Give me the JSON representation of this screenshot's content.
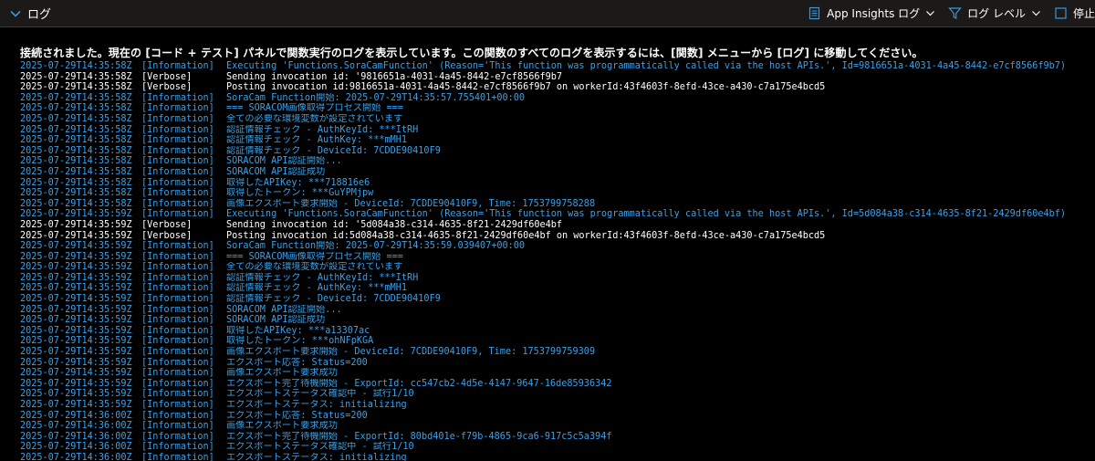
{
  "header": {
    "title": "ログ",
    "app_insights_label": "App Insights ログ",
    "log_level_label": "ログ レベル",
    "stop_label": "停止"
  },
  "colors": {
    "information": "#3aa0e8",
    "verbose": "#ffffff",
    "accent": "#3a96dd"
  },
  "notice": "接続されました。現在の [コード + テスト] パネルで関数実行のログを表示しています。この関数のすべてのログを表示するには、[関数] メニューから [ログ] に移動してください。",
  "logs": [
    {
      "ts": "2025-07-29T14:35:58Z",
      "level": "[Information]",
      "kind": "info",
      "msg": "Executing 'Functions.SoraCamFunction' (Reason='This function was programmatically called via the host APIs.', Id=9816651a-4031-4a45-8442-e7cf8566f9b7)"
    },
    {
      "ts": "2025-07-29T14:35:58Z",
      "level": "[Verbose]",
      "kind": "verb",
      "msg": "Sending invocation id: '9816651a-4031-4a45-8442-e7cf8566f9b7"
    },
    {
      "ts": "2025-07-29T14:35:58Z",
      "level": "[Verbose]",
      "kind": "verb",
      "msg": "Posting invocation id:9816651a-4031-4a45-8442-e7cf8566f9b7 on workerId:43f4603f-8efd-43ce-a430-c7a175e4bcd5"
    },
    {
      "ts": "2025-07-29T14:35:58Z",
      "level": "[Information]",
      "kind": "info",
      "msg": "SoraCam Function開始: 2025-07-29T14:35:57.755401+00:00"
    },
    {
      "ts": "2025-07-29T14:35:58Z",
      "level": "[Information]",
      "kind": "info",
      "msg": "=== SORACOM画像取得プロセス開始 ==="
    },
    {
      "ts": "2025-07-29T14:35:58Z",
      "level": "[Information]",
      "kind": "info",
      "msg": "全ての必要な環境変数が設定されています"
    },
    {
      "ts": "2025-07-29T14:35:58Z",
      "level": "[Information]",
      "kind": "info",
      "msg": "認証情報チェック - AuthKeyId: ***ItRH"
    },
    {
      "ts": "2025-07-29T14:35:58Z",
      "level": "[Information]",
      "kind": "info",
      "msg": "認証情報チェック - AuthKey: ***mMH1"
    },
    {
      "ts": "2025-07-29T14:35:58Z",
      "level": "[Information]",
      "kind": "info",
      "msg": "認証情報チェック - DeviceId: 7CDDE90410F9"
    },
    {
      "ts": "2025-07-29T14:35:58Z",
      "level": "[Information]",
      "kind": "info",
      "msg": "SORACOM API認証開始..."
    },
    {
      "ts": "2025-07-29T14:35:58Z",
      "level": "[Information]",
      "kind": "info",
      "msg": "SORACOM API認証成功"
    },
    {
      "ts": "2025-07-29T14:35:58Z",
      "level": "[Information]",
      "kind": "info",
      "msg": "取得したAPIKey: ***718816e6"
    },
    {
      "ts": "2025-07-29T14:35:58Z",
      "level": "[Information]",
      "kind": "info",
      "msg": "取得したトークン: ***GuYPMjpw"
    },
    {
      "ts": "2025-07-29T14:35:58Z",
      "level": "[Information]",
      "kind": "info",
      "msg": "画像エクスポート要求開始 - DeviceId: 7CDDE90410F9, Time: 1753799758288"
    },
    {
      "ts": "2025-07-29T14:35:59Z",
      "level": "[Information]",
      "kind": "info",
      "msg": "Executing 'Functions.SoraCamFunction' (Reason='This function was programmatically called via the host APIs.', Id=5d084a38-c314-4635-8f21-2429df60e4bf)"
    },
    {
      "ts": "2025-07-29T14:35:59Z",
      "level": "[Verbose]",
      "kind": "verb",
      "msg": "Sending invocation id: '5d084a38-c314-4635-8f21-2429df60e4bf"
    },
    {
      "ts": "2025-07-29T14:35:59Z",
      "level": "[Verbose]",
      "kind": "verb",
      "msg": "Posting invocation id:5d084a38-c314-4635-8f21-2429df60e4bf on workerId:43f4603f-8efd-43ce-a430-c7a175e4bcd5"
    },
    {
      "ts": "2025-07-29T14:35:59Z",
      "level": "[Information]",
      "kind": "info",
      "msg": "SoraCam Function開始: 2025-07-29T14:35:59.039407+00:00"
    },
    {
      "ts": "2025-07-29T14:35:59Z",
      "level": "[Information]",
      "kind": "info",
      "msg": "=== SORACOM画像取得プロセス開始 ==="
    },
    {
      "ts": "2025-07-29T14:35:59Z",
      "level": "[Information]",
      "kind": "info",
      "msg": "全ての必要な環境変数が設定されています"
    },
    {
      "ts": "2025-07-29T14:35:59Z",
      "level": "[Information]",
      "kind": "info",
      "msg": "認証情報チェック - AuthKeyId: ***ItRH"
    },
    {
      "ts": "2025-07-29T14:35:59Z",
      "level": "[Information]",
      "kind": "info",
      "msg": "認証情報チェック - AuthKey: ***mMH1"
    },
    {
      "ts": "2025-07-29T14:35:59Z",
      "level": "[Information]",
      "kind": "info",
      "msg": "認証情報チェック - DeviceId: 7CDDE90410F9"
    },
    {
      "ts": "2025-07-29T14:35:59Z",
      "level": "[Information]",
      "kind": "info",
      "msg": "SORACOM API認証開始..."
    },
    {
      "ts": "2025-07-29T14:35:59Z",
      "level": "[Information]",
      "kind": "info",
      "msg": "SORACOM API認証成功"
    },
    {
      "ts": "2025-07-29T14:35:59Z",
      "level": "[Information]",
      "kind": "info",
      "msg": "取得したAPIKey: ***a13307ac"
    },
    {
      "ts": "2025-07-29T14:35:59Z",
      "level": "[Information]",
      "kind": "info",
      "msg": "取得したトークン: ***ohNFpKGA"
    },
    {
      "ts": "2025-07-29T14:35:59Z",
      "level": "[Information]",
      "kind": "info",
      "msg": "画像エクスポート要求開始 - DeviceId: 7CDDE90410F9, Time: 1753799759309"
    },
    {
      "ts": "2025-07-29T14:35:59Z",
      "level": "[Information]",
      "kind": "info",
      "msg": "エクスポート応答: Status=200"
    },
    {
      "ts": "2025-07-29T14:35:59Z",
      "level": "[Information]",
      "kind": "info",
      "msg": "画像エクスポート要求成功"
    },
    {
      "ts": "2025-07-29T14:35:59Z",
      "level": "[Information]",
      "kind": "info",
      "msg": "エクスポート完了待機開始 - ExportId: cc547cb2-4d5e-4147-9647-16de85936342"
    },
    {
      "ts": "2025-07-29T14:35:59Z",
      "level": "[Information]",
      "kind": "info",
      "msg": "エクスポートステータス確認中 - 試行1/10"
    },
    {
      "ts": "2025-07-29T14:35:59Z",
      "level": "[Information]",
      "kind": "info",
      "msg": "エクスポートステータス: initializing"
    },
    {
      "ts": "2025-07-29T14:36:00Z",
      "level": "[Information]",
      "kind": "info",
      "msg": "エクスポート応答: Status=200"
    },
    {
      "ts": "2025-07-29T14:36:00Z",
      "level": "[Information]",
      "kind": "info",
      "msg": "画像エクスポート要求成功"
    },
    {
      "ts": "2025-07-29T14:36:00Z",
      "level": "[Information]",
      "kind": "info",
      "msg": "エクスポート完了待機開始 - ExportId: 80bd401e-f79b-4865-9ca6-917c5c5a394f"
    },
    {
      "ts": "2025-07-29T14:36:00Z",
      "level": "[Information]",
      "kind": "info",
      "msg": "エクスポートステータス確認中 - 試行1/10"
    },
    {
      "ts": "2025-07-29T14:36:00Z",
      "level": "[Information]",
      "kind": "info",
      "msg": "エクスポートステータス: initializing"
    }
  ]
}
